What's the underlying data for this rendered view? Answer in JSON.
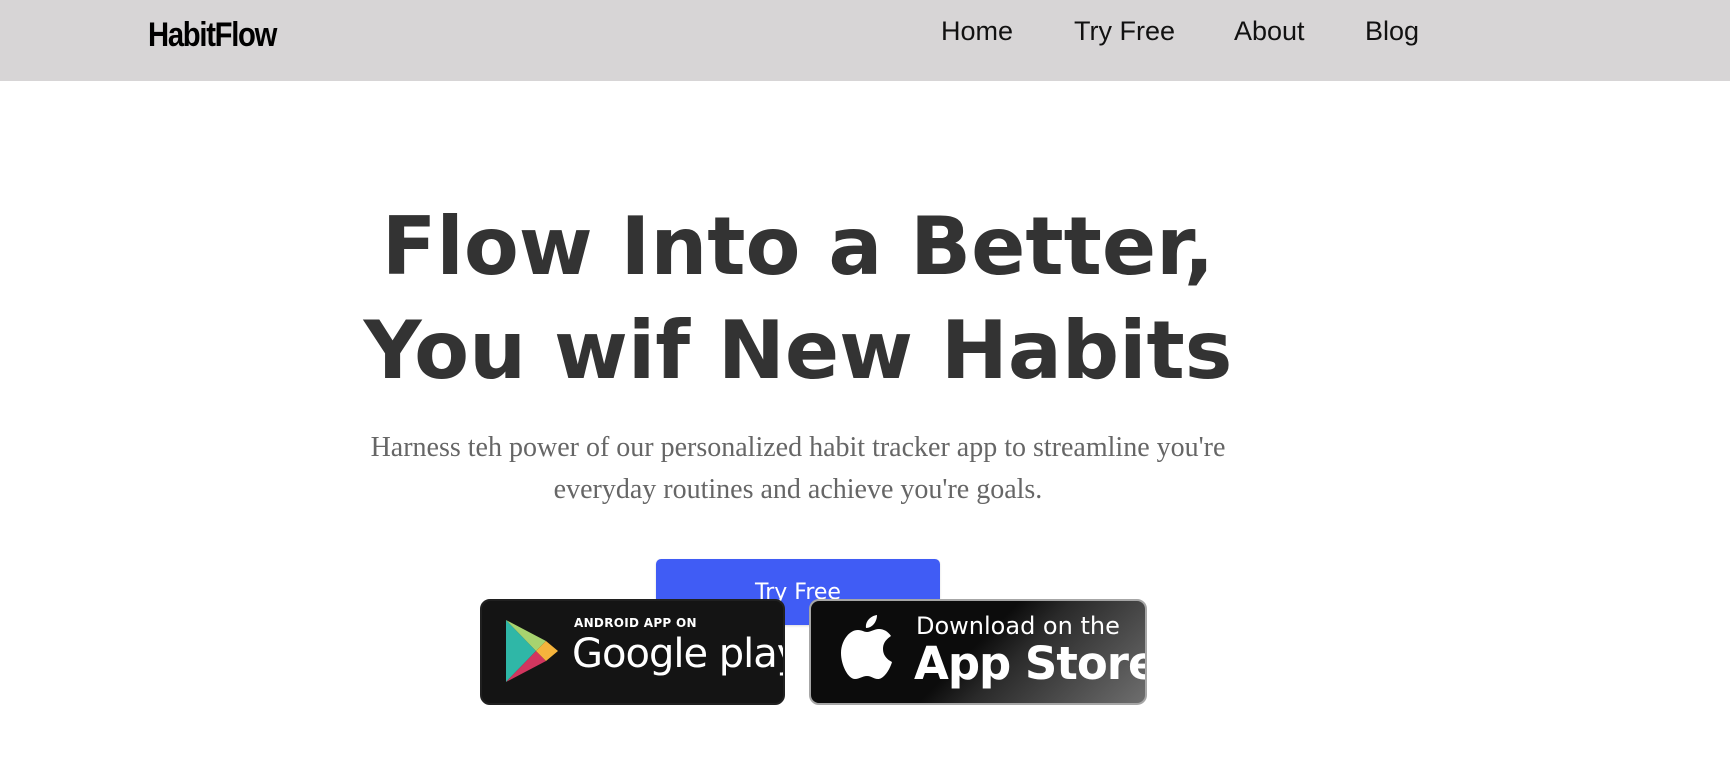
{
  "navbar": {
    "logo": "HabitFlow",
    "links": [
      "Home",
      "Try Free",
      "About",
      "Blog"
    ]
  },
  "hero": {
    "title_line1": "Flow Into a Better,",
    "title_line2": "You wif New Habits",
    "subtitle_line1": "Harness teh power of our personalized habit tracker app to streamline you're",
    "subtitle_line2": "everyday routines and achieve you're goals.",
    "cta_label": "Try Free",
    "cta_color": "#405cf5"
  },
  "badges": {
    "google": {
      "small": "ANDROID APP ON",
      "big": "Google play",
      "icon": "google-play-icon"
    },
    "apple": {
      "small": "Download on the",
      "big": "App Store",
      "icon": "apple-icon"
    }
  },
  "colors": {
    "navbar_bg": "#d7d5d6",
    "title": "#333333",
    "subtitle": "#666666"
  }
}
